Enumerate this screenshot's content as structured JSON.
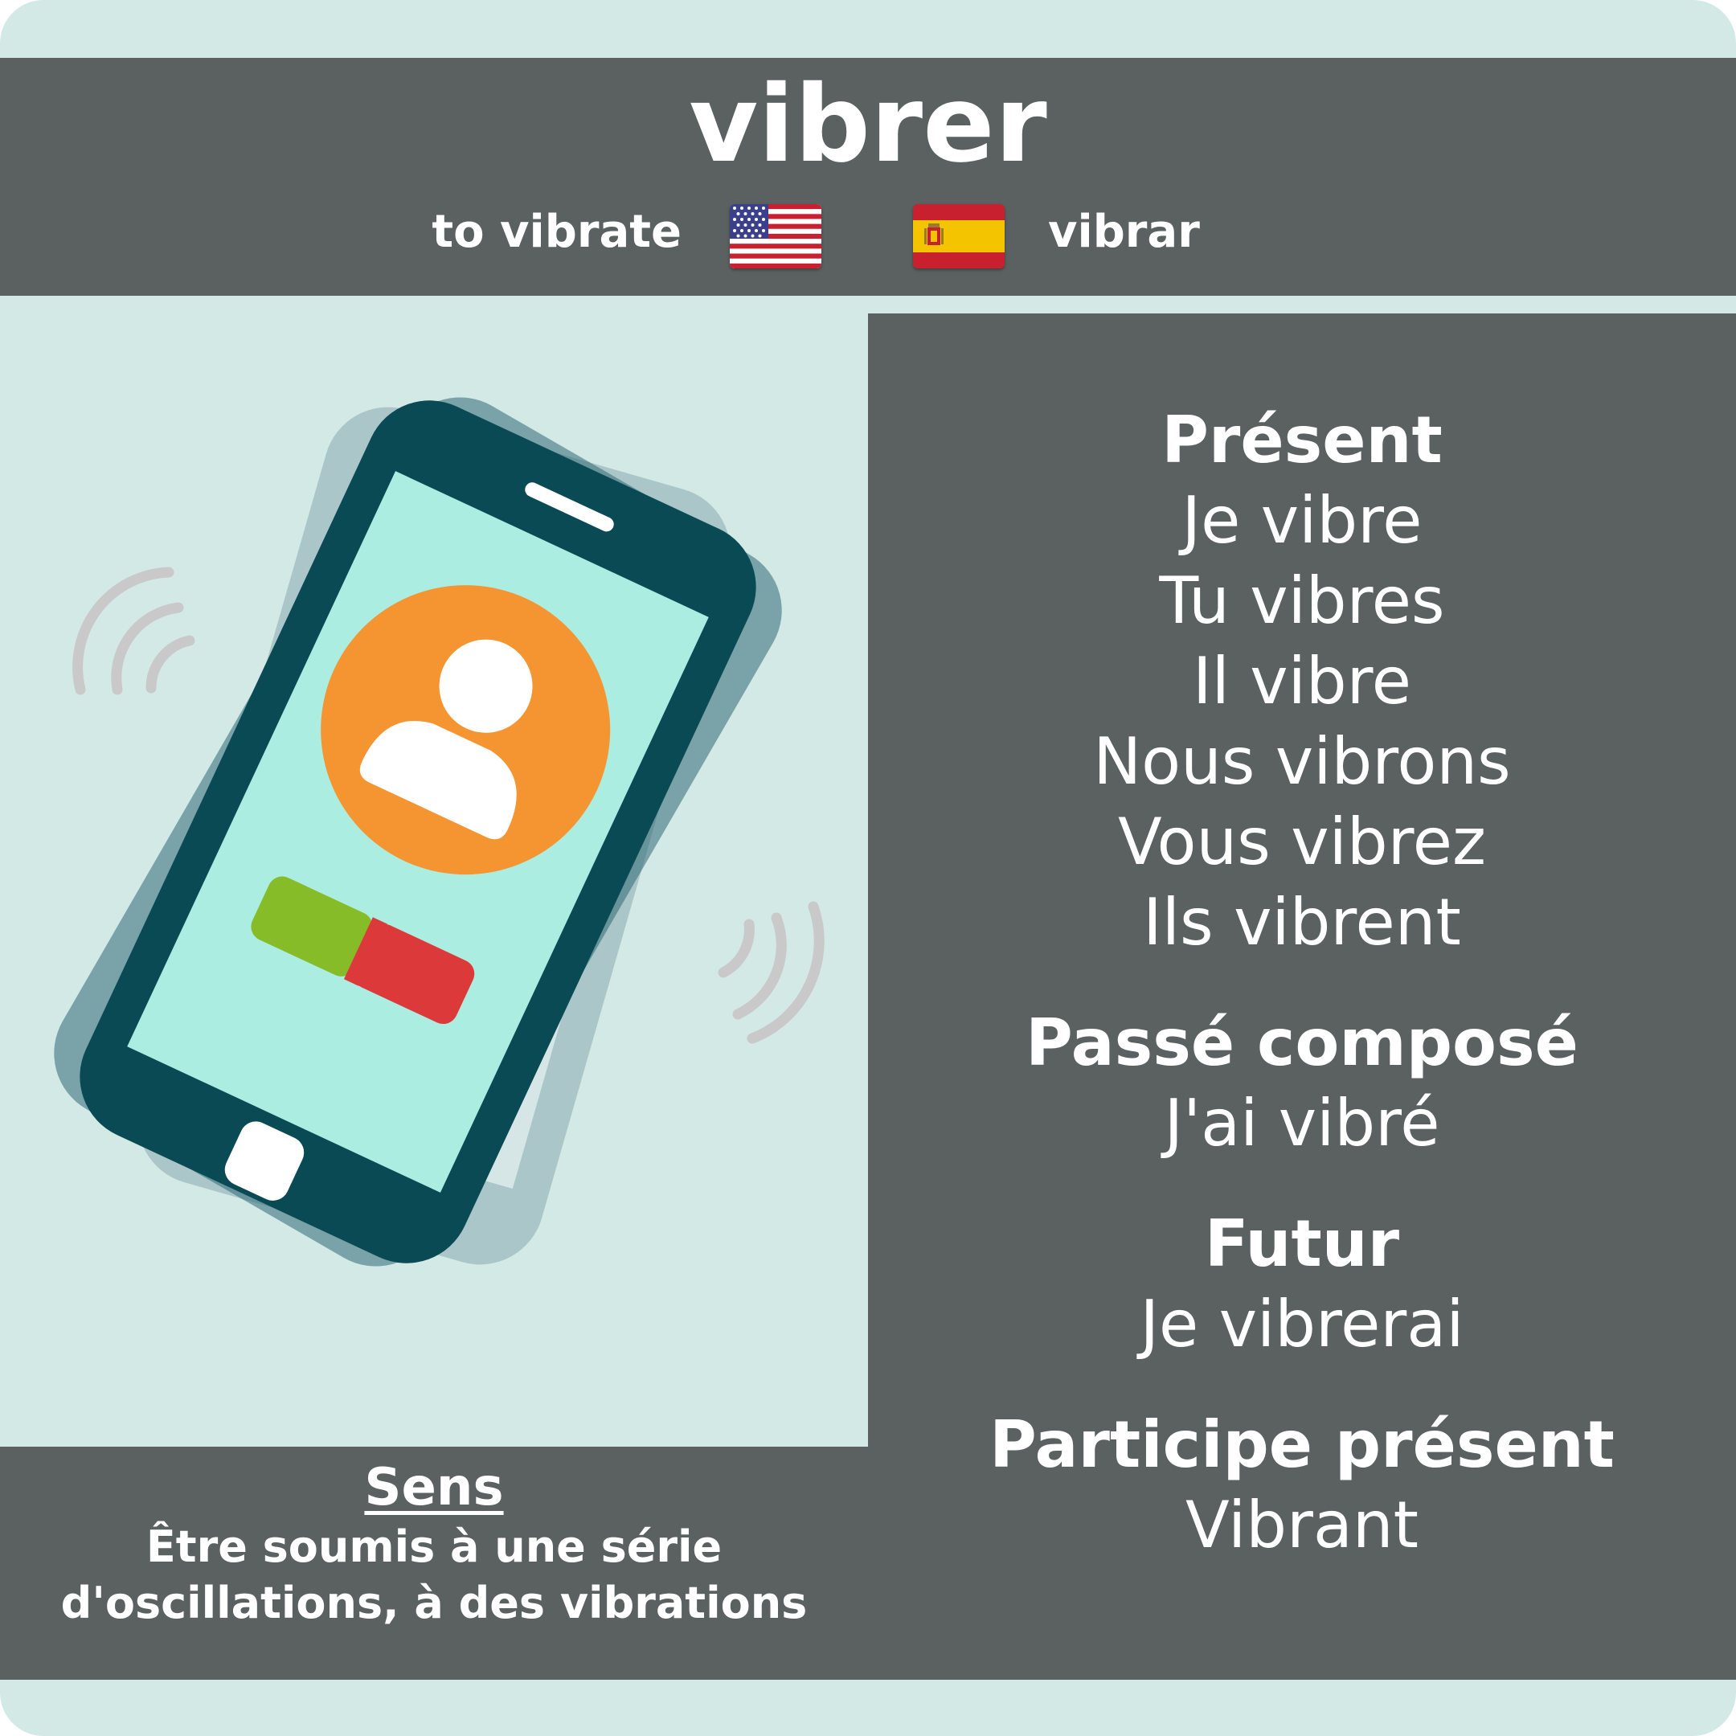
{
  "verb": "vibrer",
  "translations": {
    "english": "to vibrate",
    "spanish": "vibrar"
  },
  "icons": {
    "us_flag": "us-flag-icon",
    "spain_flag": "spain-flag-icon",
    "illustration": "vibrating-phone-illustration"
  },
  "colors": {
    "panel": "#5a6160",
    "background": "#d3e9e6",
    "phone_body": "#0a4a55",
    "screen": "#abede0",
    "avatar": "#f59532",
    "accept": "#86bc27",
    "decline": "#dc3a3a"
  },
  "meaning": {
    "title": "Sens",
    "line1": "Être soumis à une série",
    "line2": "d'oscillations, à des vibrations"
  },
  "conjugation": {
    "present": {
      "title": "Présent",
      "forms": [
        "Je vibre",
        "Tu vibres",
        "Il vibre",
        "Nous vibrons",
        "Vous vibrez",
        "Ils vibrent"
      ]
    },
    "passe_compose": {
      "title": "Passé composé",
      "form": "J'ai vibré"
    },
    "futur": {
      "title": "Futur",
      "form": "Je vibrerai"
    },
    "participe_present": {
      "title": "Participe présent",
      "form": "Vibrant"
    }
  }
}
